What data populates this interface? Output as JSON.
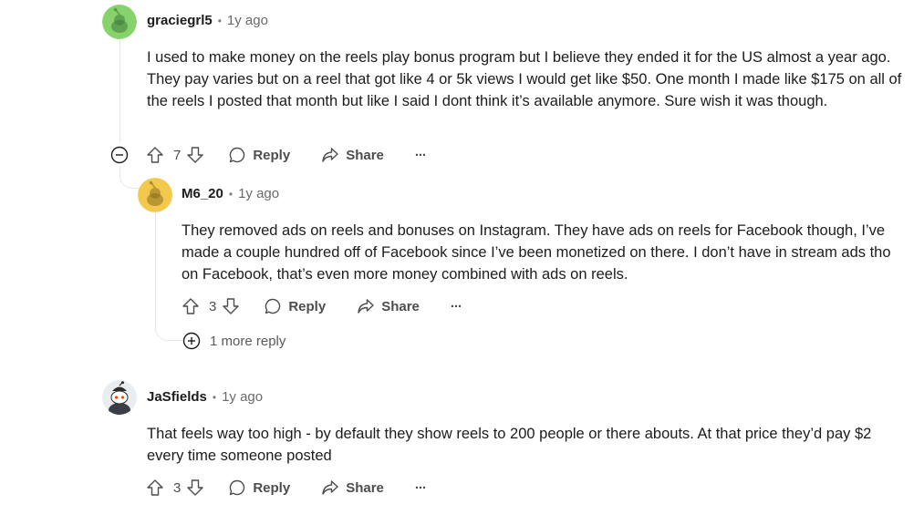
{
  "comments": [
    {
      "username": "graciegrl5",
      "separator": "•",
      "time": "1y ago",
      "body": "I used to make money on the reels play bonus program but I believe they ended it for the US almost a year ago. They pay varies but on a reel that got like 4 or 5k views I would get like $50. One month I made like $175 on all of the reels I posted that month but like I said I dont think it’s available anymore. Sure wish it was though.",
      "votes": "7",
      "reply_label": "Reply",
      "share_label": "Share",
      "more_label": "···",
      "avatar_color": "#86d36b"
    },
    {
      "username": "M6_20",
      "separator": "•",
      "time": "1y ago",
      "body": "They removed ads on reels and bonuses on Instagram. They have ads on reels for Facebook though, I’ve made a couple hundred off of Facebook since I’ve been monetized on there. I don’t have in stream ads tho on Facebook, that’s even more money combined with ads on reels.",
      "votes": "3",
      "reply_label": "Reply",
      "share_label": "Share",
      "more_label": "···",
      "avatar_color": "#f2c94c",
      "more_replies": "1 more reply"
    },
    {
      "username": "JaSfields",
      "separator": "•",
      "time": "1y ago",
      "body": "That feels way too high - by default they show reels to 200 people or there abouts. At that price they’d pay $2 every time someone posted",
      "votes": "3",
      "reply_label": "Reply",
      "share_label": "Share",
      "more_label": "···",
      "avatar_color": "#e9edf0"
    }
  ],
  "colors": {
    "text": "#1c1c1c",
    "muted": "#6a6a6a",
    "thread_line": "#e5e7e9",
    "action_text": "#4d4d4d"
  }
}
